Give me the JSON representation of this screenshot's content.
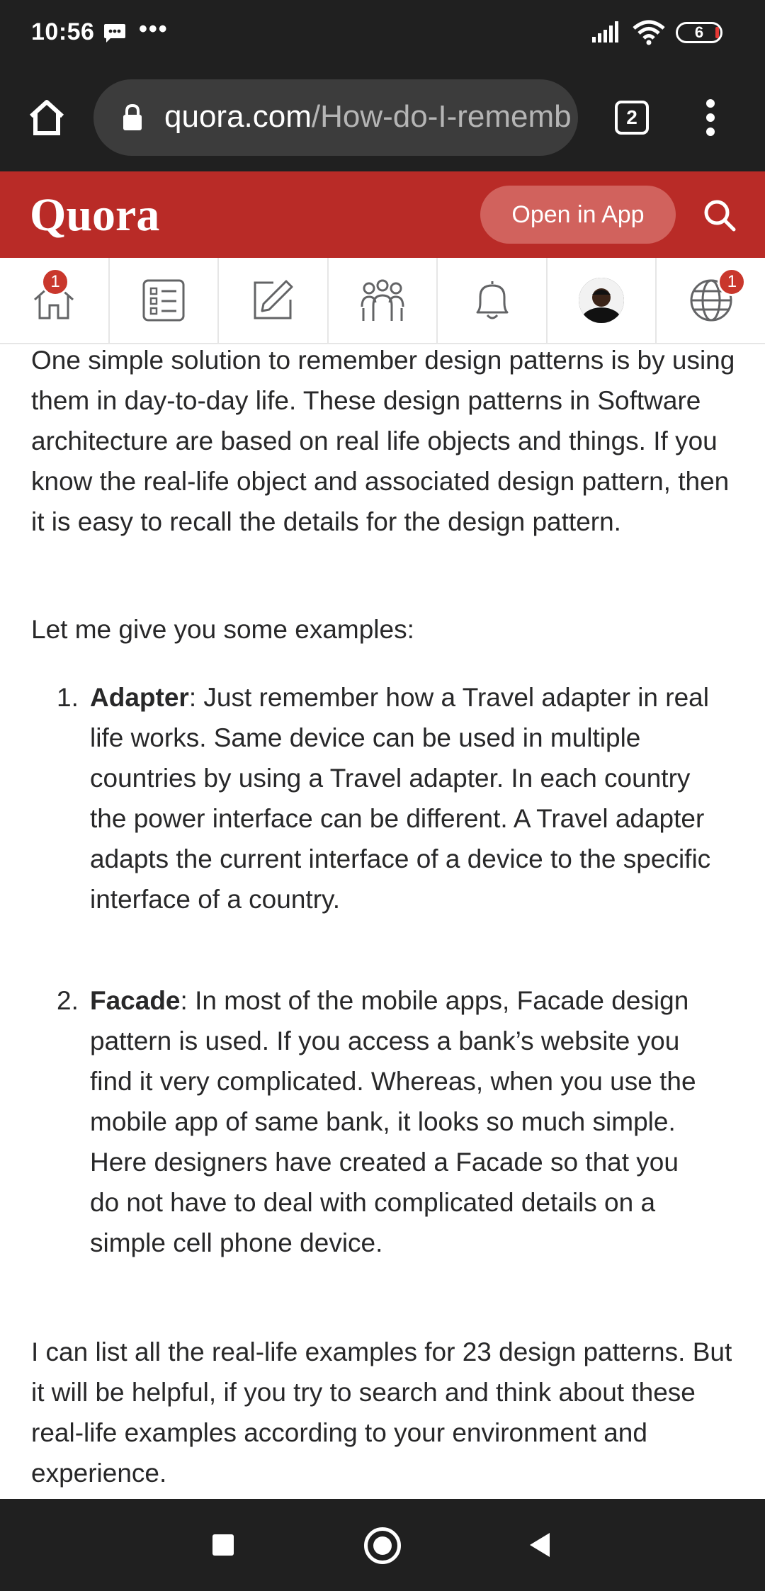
{
  "status_bar": {
    "time": "10:56",
    "dots": "•••",
    "battery": "6"
  },
  "browser": {
    "url_domain": "quora.com",
    "url_path": "/How-do-I-rememb",
    "tab_count": "2"
  },
  "header": {
    "logo": "Quora",
    "open_app_label": "Open in App"
  },
  "nav": {
    "home_badge": "1",
    "language_badge": "1"
  },
  "content": {
    "para1": "One simple solution to remember design patterns is by using them in day-to-day life. These design patterns in Software architecture are based on real life objects and things. If you know the real-life object and associated design pattern, then it is easy to recall the details for the design pattern.",
    "para2": "Let me give you some examples:",
    "list": [
      {
        "num": "1.",
        "term": "Adapter",
        "text": ": Just remember how a Travel adapter in real life works. Same device can be used in multiple countries by using a Travel adapter. In each country the power interface can be different. A Travel adapter adapts the current interface of a device to the specific interface of a country."
      },
      {
        "num": "2.",
        "term": "Facade",
        "text": ": In most of the mobile apps, Facade design pattern is used. If you access a bank’s website you find it very complicated. Whereas, when you use the mobile app of same bank, it looks so much simple. Here designers have created a Facade so that you do not have to deal with complicated details on a simple cell phone device."
      }
    ],
    "para3": "I can list all the real-life examples for 23 design patterns. But it will be helpful, if you try to search and think about these real-life examples according to your environment and experience."
  },
  "colors": {
    "quora_red": "#b92b27",
    "open_app_bg": "#d1625d",
    "badge_red": "#c9372c",
    "dark_bar": "#202020"
  },
  "icons": {
    "status": [
      "message-icon",
      "signal-icon",
      "wifi-icon",
      "battery-icon"
    ],
    "browser": [
      "home-icon",
      "lock-icon",
      "tabs-icon",
      "more-vert-icon"
    ],
    "nav": [
      "home-icon",
      "answer-list-icon",
      "write-icon",
      "spaces-icon",
      "bell-icon",
      "avatar",
      "globe-icon"
    ],
    "android": [
      "recents-square-icon",
      "home-circle-icon",
      "back-triangle-icon"
    ]
  }
}
